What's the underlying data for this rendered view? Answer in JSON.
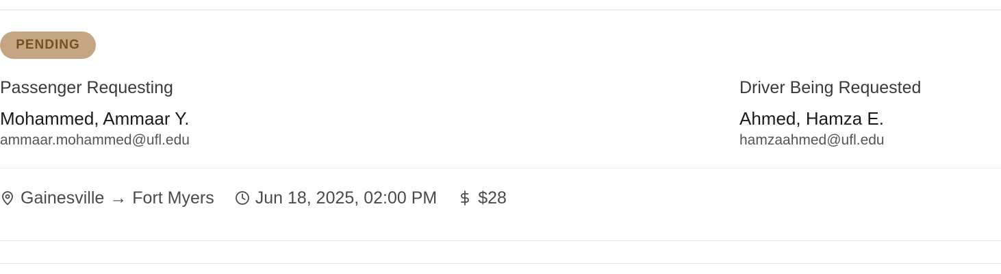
{
  "request": {
    "status": "PENDING",
    "passenger": {
      "role_label": "Passenger Requesting",
      "name": "Mohammed, Ammaar Y.",
      "email": "ammaar.mohammed@ufl.edu"
    },
    "driver": {
      "role_label": "Driver Being Requested",
      "name": "Ahmed, Hamza E.",
      "email": "hamzaahmed@ufl.edu"
    },
    "route": {
      "origin": "Gainesville",
      "arrow": "→",
      "destination": "Fort Myers"
    },
    "datetime": "Jun 18, 2025, 02:00 PM",
    "price": "$28"
  },
  "icons": {
    "location": "map-pin-icon",
    "time": "clock-icon",
    "price": "dollar-icon"
  },
  "colors": {
    "badge_bg": "#c4a584",
    "badge_text": "#7a4f20",
    "divider": "#e6e6e6"
  }
}
